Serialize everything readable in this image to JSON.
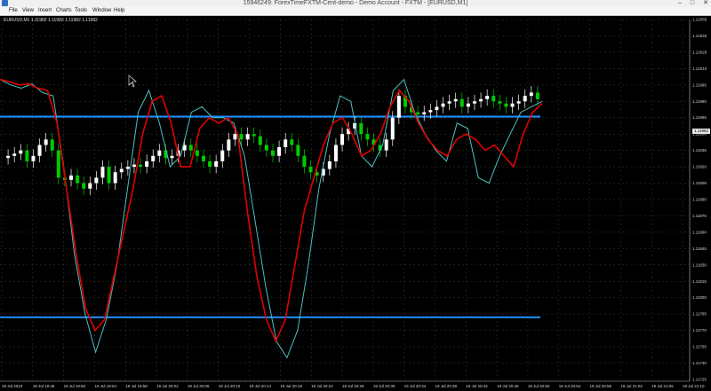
{
  "window": {
    "title": "15946249: ForexTimeFXTM-Cent-demo - Demo Account - FXTM - [EURUSD,M1]",
    "min_label": "–",
    "max_label": "□",
    "close_label": "✕"
  },
  "menu": {
    "items": [
      "File",
      "View",
      "Insert",
      "Charts",
      "Tools",
      "Window",
      "Help"
    ]
  },
  "chart": {
    "symbol_label": "EURUSD,M1 1.11982 1.11982 1.11982 1.11982",
    "current_price_label": "1.11982"
  },
  "colors": {
    "bull_candle": "#ffffff",
    "bear_candle": "#00cc00",
    "grid": "#3a3a3a",
    "level_lines": "#1e90ff",
    "red_line": "#e00000",
    "cyan_line": "#4fbfbf"
  },
  "chart_data": {
    "type": "candlestick",
    "y_ticks": [
      "1.12055",
      "1.12040",
      "1.12025",
      "1.12010",
      "1.11995",
      "1.11980",
      "1.11965",
      "1.11950",
      "1.11935",
      "1.11920",
      "1.11905",
      "1.11890",
      "1.11875",
      "1.11860",
      "1.11845",
      "1.11830",
      "1.11815",
      "1.11800",
      "1.11785",
      "1.11770",
      "1.11755",
      "1.11740",
      "1.11725"
    ],
    "x_ticks": [
      "19 Jul 2023",
      "19 Jul 19:46",
      "19 Jul 19:50",
      "19 Jul 19:54",
      "19 Jul 19:58",
      "19 Jul 20:02",
      "19 Jul 20:06",
      "19 Jul 20:10",
      "19 Jul 20:14",
      "19 Jul 20:18",
      "19 Jul 20:22",
      "19 Jul 20:26",
      "19 Jul 20:30",
      "19 Jul 20:34",
      "19 Jul 20:38",
      "19 Jul 20:42",
      "19 Jul 20:46",
      "19 Jul 20:50",
      "19 Jul 20:54",
      "19 Jul 20:58",
      "19 Jul 21:02",
      "19 Jul 21:06",
      "19 Jul 21:10"
    ],
    "y_range": [
      1.1772,
      1.1206
    ],
    "horizontal_levels": [
      1.11966,
      1.11782
    ],
    "close_series": [
      1.11928,
      1.1193,
      1.11932,
      1.11935,
      1.11925,
      1.1193,
      1.1194,
      1.11945,
      1.11935,
      1.1191,
      1.11908,
      1.11912,
      1.11905,
      1.119,
      1.11905,
      1.1191,
      1.1192,
      1.11905,
      1.11915,
      1.11918,
      1.1192,
      1.11922,
      1.1192,
      1.11925,
      1.1193,
      1.11935,
      1.11928,
      1.1193,
      1.11935,
      1.1194,
      1.11935,
      1.1193,
      1.11925,
      1.1192,
      1.11925,
      1.11935,
      1.11945,
      1.1195,
      1.11945,
      1.1195,
      1.11948,
      1.1194,
      1.11935,
      1.1193,
      1.11938,
      1.11945,
      1.1194,
      1.1193,
      1.1192,
      1.11915,
      1.11912,
      1.11918,
      1.11925,
      1.1194,
      1.1195,
      1.11955,
      1.1196,
      1.1195,
      1.11945,
      1.1194,
      1.11935,
      1.11945,
      1.11965,
      1.11985,
      1.11975,
      1.1197,
      1.11968,
      1.1197,
      1.11972,
      1.11975,
      1.11978,
      1.1198,
      1.11982,
      1.11975,
      1.11978,
      1.1198,
      1.11982,
      1.11985,
      1.1198,
      1.11978,
      1.11975,
      1.11978,
      1.1198,
      1.11985,
      1.11988,
      1.11982
    ],
    "red_series": [
      1.12,
      1.11998,
      1.11995,
      1.11996,
      1.11992,
      1.1199,
      1.1196,
      1.119,
      1.1184,
      1.1179,
      1.1177,
      1.1178,
      1.1182,
      1.1186,
      1.119,
      1.1195,
      1.1198,
      1.11985,
      1.1196,
      1.1192,
      1.1192,
      1.11955,
      1.11965,
      1.1196,
      1.11965,
      1.1195,
      1.1188,
      1.1182,
      1.1178,
      1.1176,
      1.1178,
      1.1183,
      1.1188,
      1.1191,
      1.1194,
      1.1196,
      1.11965,
      1.1195,
      1.1193,
      1.11935,
      1.1195,
      1.11975,
      1.1199,
      1.1198,
      1.1196,
      1.11945,
      1.11935,
      1.1193,
      1.11945,
      1.1195,
      1.11945,
      1.11935,
      1.1194,
      1.1193,
      1.1192,
      1.1195,
      1.1197,
      1.11978
    ],
    "cyan_series": [
      1.12,
      1.11995,
      1.11992,
      1.11996,
      1.11988,
      1.11985,
      1.1192,
      1.1184,
      1.11785,
      1.1175,
      1.1178,
      1.1183,
      1.119,
      1.1197,
      1.1199,
      1.1196,
      1.1192,
      1.1193,
      1.1197,
      1.11975,
      1.11965,
      1.11965,
      1.1196,
      1.1193,
      1.1187,
      1.1181,
      1.1176,
      1.11745,
      1.1177,
      1.1183,
      1.119,
      1.1195,
      1.11985,
      1.1198,
      1.1193,
      1.1192,
      1.1194,
      1.1199,
      1.12,
      1.1197,
      1.1195,
      1.11935,
      1.11925,
      1.1196,
      1.11955,
      1.1191,
      1.11905,
      1.1193,
      1.1195,
      1.1197,
      1.11975,
      1.1198
    ]
  }
}
